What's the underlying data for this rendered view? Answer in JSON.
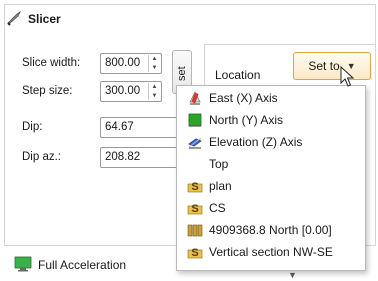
{
  "panel": {
    "title": "Slicer",
    "title_icon": "knife-icon"
  },
  "fields": {
    "slice_width": {
      "label": "Slice width:",
      "value": "800.00"
    },
    "step_size": {
      "label": "Step size:",
      "value": "300.00"
    },
    "dip": {
      "label": "Dip:",
      "value": "64.67"
    },
    "dip_az": {
      "label": "Dip az.:",
      "value": "208.82"
    }
  },
  "reset_button": {
    "label": "set"
  },
  "location": {
    "label": "Location"
  },
  "set_to_button": {
    "label": "Set to",
    "caret": "▼"
  },
  "menu": {
    "items": [
      {
        "label": "East (X) Axis",
        "icon": "east-axis-icon"
      },
      {
        "label": "North (Y) Axis",
        "icon": "north-axis-icon"
      },
      {
        "label": "Elevation (Z) Axis",
        "icon": "elevation-axis-icon"
      },
      {
        "label": "Top",
        "icon": ""
      },
      {
        "label": "plan",
        "icon": "section-s-icon"
      },
      {
        "label": "CS",
        "icon": "section-s-icon"
      },
      {
        "label": "4909368.8 North [0.00]",
        "icon": "stacked-sections-icon"
      },
      {
        "label": "Vertical section NW-SE",
        "icon": "section-s-icon"
      }
    ]
  },
  "footer": {
    "accel_label": "Full Acceleration",
    "accel_icon": "monitor-icon",
    "caret": "▼"
  },
  "colors": {
    "set_to_border": "#e3a347",
    "set_to_fill": "#fde9c7",
    "north_icon_green": "#2aa52a"
  }
}
